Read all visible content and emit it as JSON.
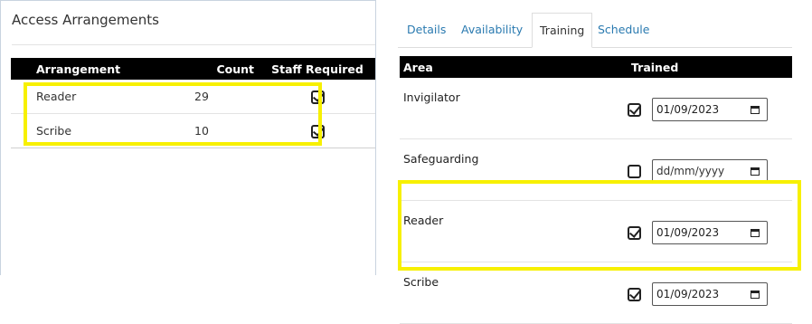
{
  "left": {
    "title": "Access Arrangements",
    "table": {
      "headers": [
        "Arrangement",
        "Count",
        "Staff Required"
      ],
      "rows": [
        {
          "name": "Reader",
          "count": "29",
          "staff_required": true
        },
        {
          "name": "Scribe",
          "count": "10",
          "staff_required": true
        }
      ]
    }
  },
  "right": {
    "tabs": [
      {
        "label": "Details",
        "active": false
      },
      {
        "label": "Availability",
        "active": false
      },
      {
        "label": "Training",
        "active": true
      },
      {
        "label": "Schedule",
        "active": false
      }
    ],
    "table": {
      "headers": [
        "Area",
        "Trained"
      ],
      "rows": [
        {
          "area": "Invigilator",
          "trained": true,
          "date": "01/09/2023"
        },
        {
          "area": "Safeguarding",
          "trained": false,
          "date": "dd/mm/yyyy"
        },
        {
          "area": "Reader",
          "trained": true,
          "date": "01/09/2023"
        },
        {
          "area": "Scribe",
          "trained": true,
          "date": "01/09/2023"
        }
      ]
    }
  },
  "colors": {
    "highlight": "#f7f000",
    "link": "#2a7ab0",
    "header_bg": "#000000"
  },
  "icons": {
    "checkbox": "check-icon",
    "calendar": "calendar-icon"
  }
}
